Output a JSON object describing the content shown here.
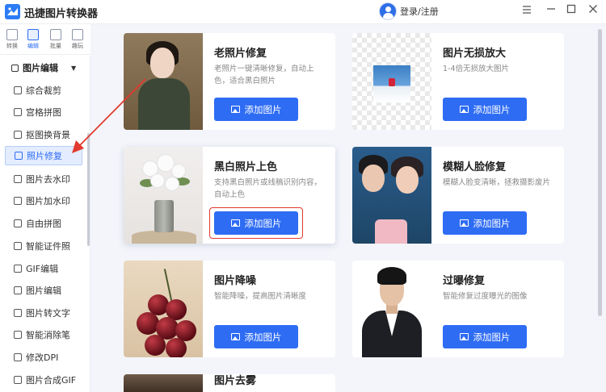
{
  "app": {
    "title": "迅捷图片转换器",
    "login_label": "登录/注册",
    "window_controls": [
      "minimize-icon",
      "maximize-icon",
      "close-icon"
    ]
  },
  "rail": {
    "items": [
      {
        "label": "转换",
        "icon": "convert-icon",
        "active": false
      },
      {
        "label": "编辑",
        "icon": "edit-icon",
        "active": true
      },
      {
        "label": "批量",
        "icon": "batch-icon",
        "active": false
      },
      {
        "label": "趣玩",
        "icon": "fun-icon",
        "active": false
      }
    ]
  },
  "sidebar": {
    "section_title": "图片编辑",
    "items": [
      {
        "label": "综合裁剪",
        "active": false
      },
      {
        "label": "宫格拼图",
        "active": false
      },
      {
        "label": "抠图换背景",
        "active": false
      },
      {
        "label": "照片修复",
        "active": true
      },
      {
        "label": "图片去水印",
        "active": false
      },
      {
        "label": "图片加水印",
        "active": false
      },
      {
        "label": "自由拼图",
        "active": false
      },
      {
        "label": "智能证件照",
        "active": false
      },
      {
        "label": "GIF编辑",
        "active": false
      },
      {
        "label": "图片编辑",
        "active": false
      },
      {
        "label": "图片转文字",
        "active": false
      },
      {
        "label": "智能消除笔",
        "active": false
      },
      {
        "label": "修改DPI",
        "active": false
      },
      {
        "label": "图片合成GIF",
        "active": false
      }
    ]
  },
  "cards": [
    {
      "title": "老照片修复",
      "desc": "老照片一键清晰修复，自动上色，适合黑白照片",
      "button": "添加图片",
      "thumb": "old-photo"
    },
    {
      "title": "图片无损放大",
      "desc": "1-4倍无损放大图片",
      "button": "添加图片",
      "thumb": "upscale"
    },
    {
      "title": "黑白照片上色",
      "desc": "支持黑白照片或线稿识别内容，自动上色",
      "button": "添加图片",
      "thumb": "colorize"
    },
    {
      "title": "模糊人脸修复",
      "desc": "模糊人脸变清晰，拯救摄影废片",
      "button": "添加图片",
      "thumb": "face"
    },
    {
      "title": "图片降噪",
      "desc": "智能降噪，提高图片清晰度",
      "button": "添加图片",
      "thumb": "denoise"
    },
    {
      "title": "过曝修复",
      "desc": "智能修复过度曝光的图像",
      "button": "添加图片",
      "thumb": "overexposure"
    },
    {
      "title": "图片去雾",
      "desc": "",
      "button": "",
      "thumb": "dehaze"
    }
  ],
  "colors": {
    "accent": "#2e6cf4",
    "highlight_border": "#e23a2e",
    "arrow": "#e23a2e",
    "main_bg": "#f3f5fa"
  }
}
